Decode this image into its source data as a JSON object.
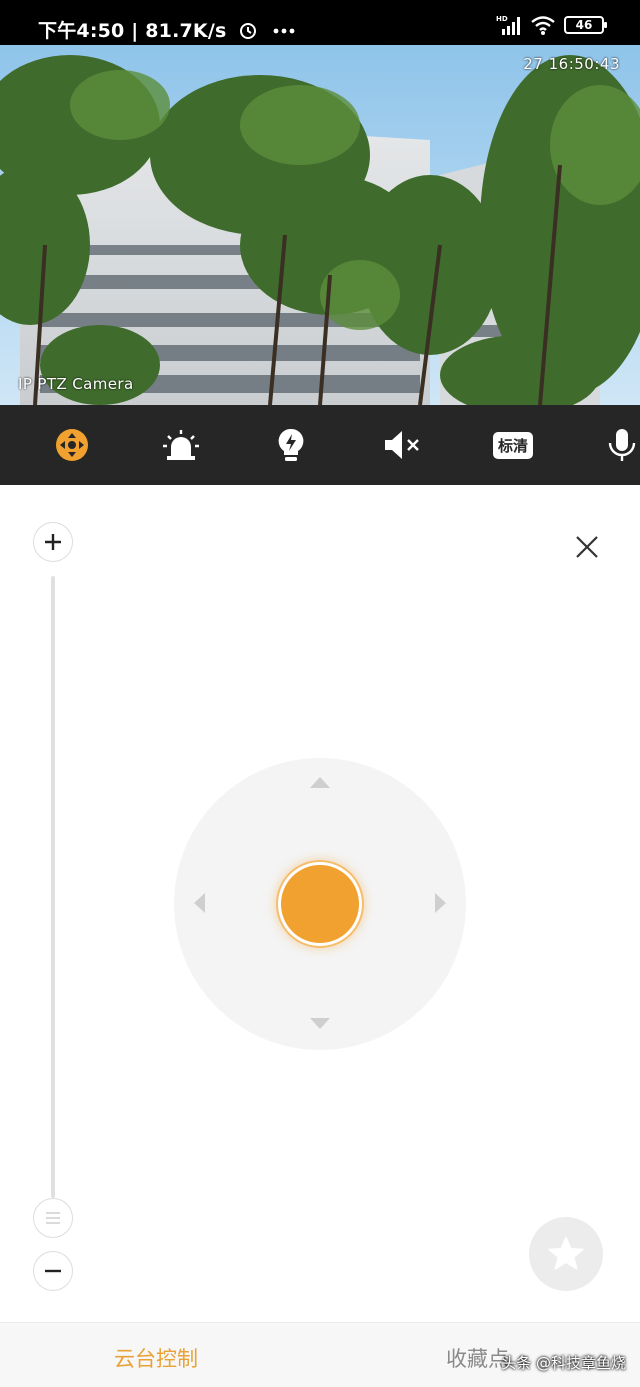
{
  "status_bar": {
    "time_speed": "下午4:50 | 81.7K/s",
    "battery": "46"
  },
  "video": {
    "timestamp": "27 16:50:43",
    "camera_label": "IP PTZ Camera"
  },
  "toolbar": {
    "items": [
      {
        "icon": "ptz-control-icon",
        "active": true
      },
      {
        "icon": "alarm-siren-icon"
      },
      {
        "icon": "light-bulb-icon"
      },
      {
        "icon": "mute-icon"
      },
      {
        "icon": "quality-badge",
        "label": "标清"
      },
      {
        "icon": "microphone-icon"
      }
    ]
  },
  "ptz_panel": {
    "zoom_in_icon": "plus-icon",
    "zoom_out_icon": "minus-icon",
    "zoom_handle_icon": "slider-handle-icon",
    "close_icon": "close-icon",
    "favorite_icon": "star-icon",
    "accent_color": "#f0a130"
  },
  "tabs": {
    "ptz": "云台控制",
    "favorites": "收藏点"
  },
  "watermark": "头条 @科技章鱼烧"
}
